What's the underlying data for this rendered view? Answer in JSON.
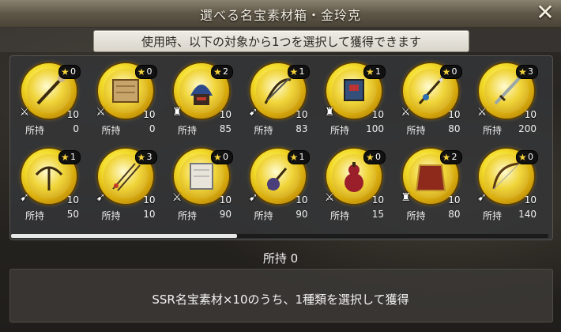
{
  "dialog": {
    "title": "選べる名宝素材箱・金玲克",
    "close_label": "✕",
    "instruction": "使用時、以下の対象から1つを選択して獲得できます"
  },
  "owned_label": "所持",
  "items": [
    {
      "icon": "staff-icon",
      "stars": "0",
      "quantity": "10",
      "owned": "0",
      "type": "sword-type-icon",
      "type_glyph": "⚔"
    },
    {
      "icon": "scroll-icon",
      "stars": "0",
      "quantity": "10",
      "owned": "0",
      "type": "sword-type-icon",
      "type_glyph": "⚔"
    },
    {
      "icon": "helmet-icon",
      "stars": "2",
      "quantity": "10",
      "owned": "85",
      "type": "armor-type-icon",
      "type_glyph": "♜"
    },
    {
      "icon": "bow-arrows-icon",
      "stars": "1",
      "quantity": "10",
      "owned": "83",
      "type": "bow-type-icon",
      "type_glyph": "➹"
    },
    {
      "icon": "armor-icon",
      "stars": "1",
      "quantity": "10",
      "owned": "100",
      "type": "armor-type-icon",
      "type_glyph": "♜"
    },
    {
      "icon": "spear-icon",
      "stars": "0",
      "quantity": "10",
      "owned": "80",
      "type": "sword-type-icon",
      "type_glyph": "⚔"
    },
    {
      "icon": "blade-icon",
      "stars": "3",
      "quantity": "10",
      "owned": "200",
      "type": "sword-type-icon",
      "type_glyph": "⚔"
    },
    {
      "icon": "crossbow-icon",
      "stars": "1",
      "quantity": "10",
      "owned": "50",
      "type": "bow-type-icon",
      "type_glyph": "➹"
    },
    {
      "icon": "arrows-icon",
      "stars": "3",
      "quantity": "10",
      "owned": "10",
      "type": "bow-type-icon",
      "type_glyph": "➹"
    },
    {
      "icon": "scroll-sheet-icon",
      "stars": "0",
      "quantity": "10",
      "owned": "90",
      "type": "sword-type-icon",
      "type_glyph": "⚔"
    },
    {
      "icon": "mace-icon",
      "stars": "1",
      "quantity": "10",
      "owned": "90",
      "type": "bow-type-icon",
      "type_glyph": "➹"
    },
    {
      "icon": "gourd-icon",
      "stars": "0",
      "quantity": "10",
      "owned": "15",
      "type": "sword-type-icon",
      "type_glyph": "⚔"
    },
    {
      "icon": "cape-icon",
      "stars": "2",
      "quantity": "10",
      "owned": "80",
      "type": "armor-type-icon",
      "type_glyph": "♜"
    },
    {
      "icon": "longbow-icon",
      "stars": "0",
      "quantity": "10",
      "owned": "140",
      "type": "bow-type-icon",
      "type_glyph": "➹"
    }
  ],
  "scroll": {
    "position": 0.42
  },
  "selected_owned": {
    "label": "所持",
    "value": "0"
  },
  "description": "SSR名宝素材×10のうち、1種類を選択して獲得",
  "colors": {
    "star": "#f5d33a",
    "ring": "#f3dc2a",
    "panel": "#343638"
  }
}
